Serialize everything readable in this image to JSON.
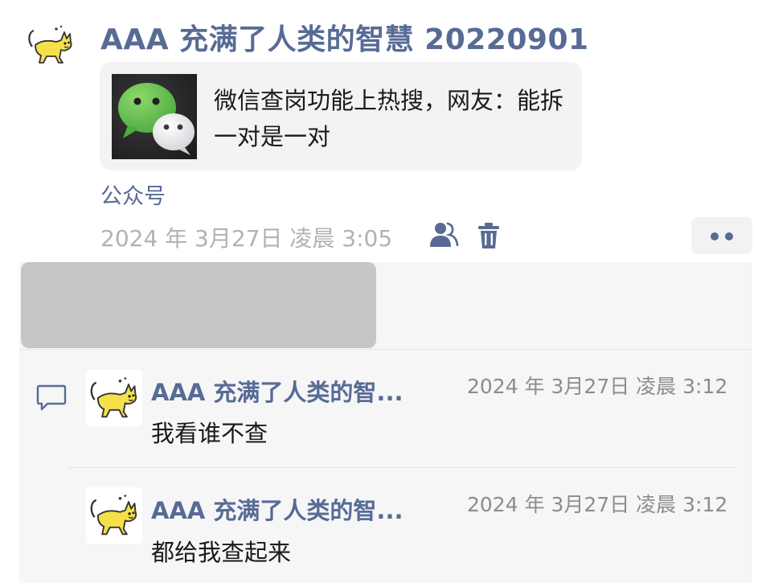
{
  "post": {
    "author": "AAA 充满了人类的智慧 20220901",
    "article": {
      "title": "微信查岗功能上热搜，网友：能拆一对是一对",
      "thumbnail_icon": "wechat-logo-icon"
    },
    "source": "公众号",
    "time": "2024 年 3月27日 凌晨 3:05"
  },
  "likes": {
    "content_redacted": true
  },
  "comments": [
    {
      "author": "AAA 充满了人类的智...",
      "time": "2024 年 3月27日 凌晨 3:12",
      "text": "我看谁不查"
    },
    {
      "author": "AAA 充满了人类的智...",
      "time": "2024 年 3月27日 凌晨 3:12",
      "text": "都给我查起来"
    }
  ],
  "colors": {
    "link": "#576b95",
    "meta": "#b2b2b2",
    "card": "#f3f3f5",
    "interaction_bg": "#f6f6f7",
    "redaction": "#c6c6c6"
  }
}
